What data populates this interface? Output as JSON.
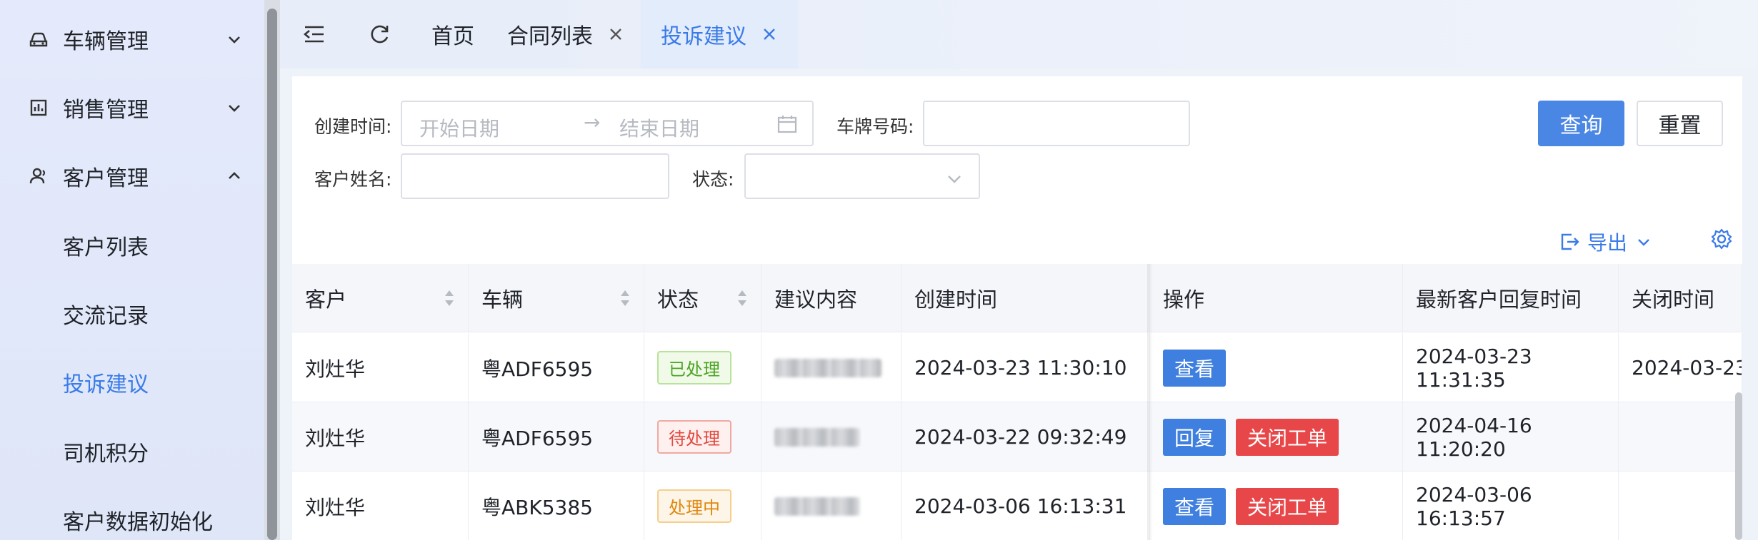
{
  "sidebar": {
    "groups": [
      {
        "label": "车辆管理",
        "icon": "car-icon",
        "expanded": false
      },
      {
        "label": "销售管理",
        "icon": "chart-icon",
        "expanded": false
      },
      {
        "label": "客户管理",
        "icon": "user-icon",
        "expanded": true
      }
    ],
    "sub_items": [
      {
        "label": "客户列表",
        "active": false
      },
      {
        "label": "交流记录",
        "active": false
      },
      {
        "label": "投诉建议",
        "active": true
      },
      {
        "label": "司机积分",
        "active": false
      },
      {
        "label": "客户数据初始化",
        "active": false
      }
    ]
  },
  "tabs": {
    "items": [
      {
        "label": "首页",
        "closable": false,
        "active": false
      },
      {
        "label": "合同列表",
        "closable": true,
        "active": false
      },
      {
        "label": "投诉建议",
        "closable": true,
        "active": true
      }
    ]
  },
  "filters": {
    "created_time_label": "创建时间:",
    "start_date_placeholder": "开始日期",
    "range_separator": "→",
    "end_date_placeholder": "结束日期",
    "plate_label": "车牌号码:",
    "plate_value": "",
    "customer_name_label": "客户姓名:",
    "customer_name_value": "",
    "status_label": "状态:",
    "status_value": "",
    "query_button": "查询",
    "reset_button": "重置"
  },
  "toolbar": {
    "export_label": "导出"
  },
  "table": {
    "columns": [
      "客户",
      "车辆",
      "状态",
      "建议内容",
      "创建时间",
      "操作",
      "最新客户回复时间",
      "关闭时间"
    ],
    "rows": [
      {
        "customer": "刘灶华",
        "vehicle": "粤ADF6595",
        "status": "已处理",
        "status_color": "#4aa523",
        "created": "2024-03-23 11:30:10",
        "actions": [
          "查看"
        ],
        "last_reply": "2024-03-23 11:31:35",
        "closed": "2024-03-23"
      },
      {
        "customer": "刘灶华",
        "vehicle": "粤ADF6595",
        "status": "待处理",
        "status_color": "#e2483d",
        "created": "2024-03-22 09:32:49",
        "actions": [
          "回复",
          "关闭工单"
        ],
        "last_reply": "2024-04-16 11:20:20",
        "closed": ""
      },
      {
        "customer": "刘灶华",
        "vehicle": "粤ABK5385",
        "status": "处理中",
        "status_color": "#e0870c",
        "created": "2024-03-06 16:13:31",
        "actions": [
          "查看",
          "关闭工单"
        ],
        "last_reply": "2024-03-06 16:13:57",
        "closed": ""
      }
    ]
  },
  "colors": {
    "accent": "#3a7be8",
    "primary_button": "#4a86e4",
    "danger_button": "#e8474a"
  }
}
